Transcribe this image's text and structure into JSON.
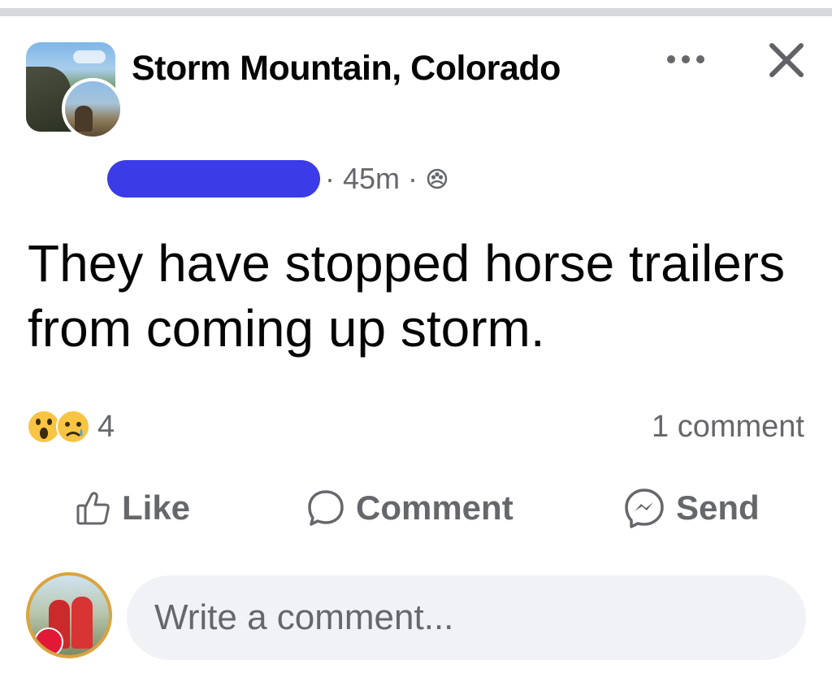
{
  "group": {
    "name": "Storm Mountain, Colorado",
    "avatar_icon": "group-landscape-photo",
    "member_avatar_icon": "user-horse-photo"
  },
  "header": {
    "more_icon": "ellipsis-icon",
    "close_icon": "close-icon"
  },
  "meta": {
    "author": "[redacted]",
    "timestamp": "· 45m ·",
    "audience_icon": "group-audience-icon"
  },
  "post": {
    "text": "They have stopped horse trailers from coming up storm."
  },
  "engagement": {
    "reaction_icons": [
      "wow-reaction-icon",
      "sad-reaction-icon"
    ],
    "reaction_count": "4",
    "comment_count": "1 comment"
  },
  "actions": {
    "like_label": "Like",
    "comment_label": "Comment",
    "send_label": "Send"
  },
  "composer": {
    "placeholder": "Write a comment..."
  },
  "colors": {
    "secondary_text": "#65676b",
    "redaction": "#3b3be8",
    "input_bg": "#f0f2f5"
  }
}
